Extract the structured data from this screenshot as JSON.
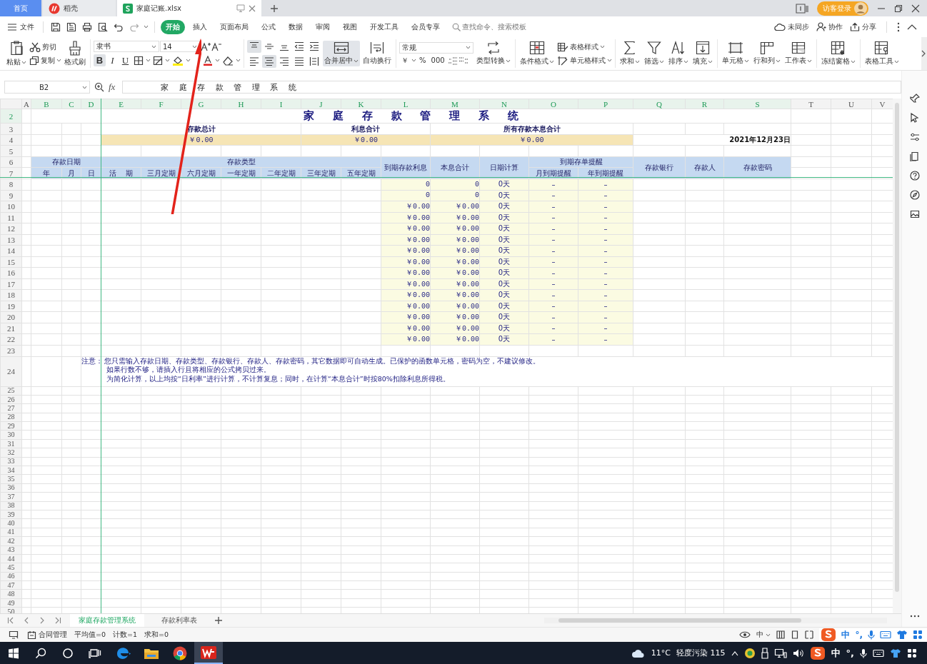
{
  "window_tabs": [
    {
      "label": "首页",
      "selected": false,
      "kind": "home"
    },
    {
      "label": "稻壳",
      "selected": false,
      "kind": "docer"
    },
    {
      "label": "家庭记账.xlsx",
      "selected": true,
      "kind": "file"
    }
  ],
  "account": {
    "login": "访客登录"
  },
  "menu": {
    "file": "文件",
    "tabs": [
      {
        "label": "开始",
        "selected": true
      },
      {
        "label": "插入",
        "selected": false
      },
      {
        "label": "页面布局",
        "selected": false
      },
      {
        "label": "公式",
        "selected": false
      },
      {
        "label": "数据",
        "selected": false
      },
      {
        "label": "审阅",
        "selected": false
      },
      {
        "label": "视图",
        "selected": false
      },
      {
        "label": "开发工具",
        "selected": false
      },
      {
        "label": "会员专享",
        "selected": false
      }
    ],
    "search_placeholder": "查找命令、搜索模板",
    "actions": [
      "未同步",
      "协作",
      "分享"
    ]
  },
  "ribbon": {
    "paste": "粘贴",
    "cut": "剪切",
    "copy": "复制",
    "format_painter": "格式刷",
    "font_name": "隶书",
    "font_size": "14",
    "styles": [
      {
        "label": "B",
        "on": true
      },
      {
        "label": "I",
        "on": false
      },
      {
        "label": "U",
        "on": false
      }
    ],
    "align_top": [
      {
        "on": true
      },
      {
        "on": false
      },
      {
        "on": false
      },
      {
        "on": false
      },
      {
        "on": false
      }
    ],
    "align_bottom": [
      {
        "on": false
      },
      {
        "on": true
      },
      {
        "on": false
      },
      {
        "on": false
      },
      {
        "on": false
      }
    ],
    "merge": {
      "label": "合并居中",
      "on": true
    },
    "wrap": {
      "label": "自动换行",
      "on": false
    },
    "number_format": "常规",
    "number_buttons": [
      "￥",
      "%",
      "000"
    ],
    "tools": [
      [
        {
          "label": "类型转换",
          "kind": "large"
        }
      ],
      [
        {
          "label": "条件格式",
          "kind": "large"
        },
        {
          "label": "表格样式",
          "kind": "small"
        },
        {
          "label": "单元格样式",
          "kind": "small"
        }
      ],
      [
        {
          "label": "求和",
          "kind": "large"
        },
        {
          "label": "筛选",
          "kind": "large"
        },
        {
          "label": "排序",
          "kind": "large"
        },
        {
          "label": "填充",
          "kind": "large"
        }
      ],
      [
        {
          "label": "单元格",
          "kind": "large"
        },
        {
          "label": "行和列",
          "kind": "large"
        },
        {
          "label": "工作表",
          "kind": "large"
        }
      ],
      [
        {
          "label": "冻结窗格",
          "kind": "large"
        }
      ],
      [
        {
          "label": "表格工具",
          "kind": "large"
        }
      ]
    ]
  },
  "formula_bar": {
    "cell": "B2",
    "fx": "fx",
    "content": "家 庭 存 款 管 理 系 统"
  },
  "columns": [
    {
      "label": "A",
      "selected": false
    },
    {
      "label": "B",
      "selected": true
    },
    {
      "label": "C",
      "selected": true
    },
    {
      "label": "D",
      "selected": true
    },
    {
      "label": "E",
      "selected": true
    },
    {
      "label": "F",
      "selected": true
    },
    {
      "label": "G",
      "selected": true
    },
    {
      "label": "H",
      "selected": true
    },
    {
      "label": "I",
      "selected": true
    },
    {
      "label": "J",
      "selected": true
    },
    {
      "label": "K",
      "selected": true
    },
    {
      "label": "L",
      "selected": true
    },
    {
      "label": "M",
      "selected": true
    },
    {
      "label": "N",
      "selected": true
    },
    {
      "label": "O",
      "selected": true
    },
    {
      "label": "P",
      "selected": true
    },
    {
      "label": "Q",
      "selected": true
    },
    {
      "label": "R",
      "selected": true
    },
    {
      "label": "S",
      "selected": true
    },
    {
      "label": "T",
      "selected": false
    },
    {
      "label": "U",
      "selected": false
    },
    {
      "label": "V",
      "selected": false
    }
  ],
  "row_numbers": [
    {
      "label": "2",
      "selected": true
    },
    {
      "label": "3",
      "selected": false
    },
    {
      "label": "4",
      "selected": false
    },
    {
      "label": "5",
      "selected": false
    },
    {
      "label": "6",
      "selected": false
    },
    {
      "label": "7",
      "selected": false
    },
    {
      "label": "8",
      "selected": false
    },
    {
      "label": "9",
      "selected": false
    },
    {
      "label": "10",
      "selected": false
    },
    {
      "label": "11",
      "selected": false
    },
    {
      "label": "12",
      "selected": false
    },
    {
      "label": "13",
      "selected": false
    },
    {
      "label": "14",
      "selected": false
    },
    {
      "label": "15",
      "selected": false
    },
    {
      "label": "16",
      "selected": false
    },
    {
      "label": "17",
      "selected": false
    },
    {
      "label": "18",
      "selected": false
    },
    {
      "label": "19",
      "selected": false
    },
    {
      "label": "20",
      "selected": false
    },
    {
      "label": "21",
      "selected": false
    },
    {
      "label": "22",
      "selected": false
    },
    {
      "label": "23",
      "selected": false
    },
    {
      "label": "24",
      "selected": false
    },
    {
      "label": "25",
      "selected": false
    },
    {
      "label": "26",
      "selected": false
    },
    {
      "label": "27",
      "selected": false
    },
    {
      "label": "28",
      "selected": false
    },
    {
      "label": "29",
      "selected": false
    },
    {
      "label": "30",
      "selected": false
    },
    {
      "label": "31",
      "selected": false
    },
    {
      "label": "32",
      "selected": false
    },
    {
      "label": "33",
      "selected": false
    },
    {
      "label": "34",
      "selected": false
    },
    {
      "label": "35",
      "selected": false
    },
    {
      "label": "36",
      "selected": false
    },
    {
      "label": "37",
      "selected": false
    },
    {
      "label": "38",
      "selected": false
    },
    {
      "label": "39",
      "selected": false
    },
    {
      "label": "40",
      "selected": false
    },
    {
      "label": "41",
      "selected": false
    },
    {
      "label": "42",
      "selected": false
    },
    {
      "label": "43",
      "selected": false
    },
    {
      "label": "44",
      "selected": false
    },
    {
      "label": "45",
      "selected": false
    },
    {
      "label": "46",
      "selected": false
    },
    {
      "label": "47",
      "selected": false
    },
    {
      "label": "48",
      "selected": false
    },
    {
      "label": "49",
      "selected": false
    },
    {
      "label": "50",
      "selected": false
    }
  ],
  "sheet": {
    "title": "家 庭 存 款 管 理 系 统",
    "summary": [
      {
        "label": "存款总计",
        "value": "￥0.00"
      },
      {
        "label": "利息合计",
        "value": "￥0.00"
      },
      {
        "label": "所有存款本息合计",
        "value": "￥0.00"
      }
    ],
    "date": "2021年12月23日",
    "date_group": {
      "label": "存款日期",
      "columns": [
        "年",
        "月",
        "日"
      ]
    },
    "type_group": {
      "label": "存款类型",
      "columns": [
        "活 期",
        "三月定期",
        "六月定期",
        "一年定期",
        "二年定期",
        "三年定期",
        "五年定期"
      ]
    },
    "calc_columns": [
      "到期存款利息",
      "本息合计",
      "日期计算"
    ],
    "reminder_group": {
      "label": "到期存单提醒",
      "columns": [
        "月到期提醒",
        "年到期提醒"
      ]
    },
    "info_columns": [
      "存款银行",
      "存款人",
      "存款密码"
    ],
    "rows": [
      {
        "interest": "0",
        "total": "0",
        "days": "0天",
        "month_reminder": "–",
        "year_reminder": "–"
      },
      {
        "interest": "0",
        "total": "0",
        "days": "0天",
        "month_reminder": "–",
        "year_reminder": "–"
      },
      {
        "interest": "￥0.00",
        "total": "￥0.00",
        "days": "0天",
        "month_reminder": "–",
        "year_reminder": "–"
      },
      {
        "interest": "￥0.00",
        "total": "￥0.00",
        "days": "0天",
        "month_reminder": "–",
        "year_reminder": "–"
      },
      {
        "interest": "￥0.00",
        "total": "￥0.00",
        "days": "0天",
        "month_reminder": "–",
        "year_reminder": "–"
      },
      {
        "interest": "￥0.00",
        "total": "￥0.00",
        "days": "0天",
        "month_reminder": "–",
        "year_reminder": "–"
      },
      {
        "interest": "￥0.00",
        "total": "￥0.00",
        "days": "0天",
        "month_reminder": "–",
        "year_reminder": "–"
      },
      {
        "interest": "￥0.00",
        "total": "￥0.00",
        "days": "0天",
        "month_reminder": "–",
        "year_reminder": "–"
      },
      {
        "interest": "￥0.00",
        "total": "￥0.00",
        "days": "0天",
        "month_reminder": "–",
        "year_reminder": "–"
      },
      {
        "interest": "￥0.00",
        "total": "￥0.00",
        "days": "0天",
        "month_reminder": "–",
        "year_reminder": "–"
      },
      {
        "interest": "￥0.00",
        "total": "￥0.00",
        "days": "0天",
        "month_reminder": "–",
        "year_reminder": "–"
      },
      {
        "interest": "￥0.00",
        "total": "￥0.00",
        "days": "0天",
        "month_reminder": "–",
        "year_reminder": "–"
      },
      {
        "interest": "￥0.00",
        "total": "￥0.00",
        "days": "0天",
        "month_reminder": "–",
        "year_reminder": "–"
      },
      {
        "interest": "￥0.00",
        "total": "￥0.00",
        "days": "0天",
        "month_reminder": "–",
        "year_reminder": "–"
      },
      {
        "interest": "￥0.00",
        "total": "￥0.00",
        "days": "0天",
        "month_reminder": "–",
        "year_reminder": "–"
      }
    ],
    "note": {
      "label": "注意：",
      "lines": [
        "您只需输入存款日期、存款类型、存款银行、存款人、存款密码，其它数据即可自动生成。已保护的函数单元格，密码为空，不建议修改。",
        "如果行数不够，请插入行且将相应的公式拷贝过来。",
        "为简化计算，以上均按“日利率”进行计算，不计算复息；同时，在计算“本息合计”时按80%扣除利息所得税。"
      ]
    }
  },
  "sheet_tabs": [
    {
      "label": "家庭存款管理系统",
      "selected": true
    },
    {
      "label": "存款利率表",
      "selected": false
    }
  ],
  "status_bar": {
    "items": [
      "合同管理",
      "平均值=0",
      "计数=1",
      "求和=0"
    ],
    "input_mode": "中"
  },
  "ime_bar": {
    "mode": "中",
    "punct": "°,"
  },
  "taskbar": {
    "temperature": "11°C",
    "air": "轻度污染 115",
    "ime": "中",
    "punct": "°,"
  }
}
